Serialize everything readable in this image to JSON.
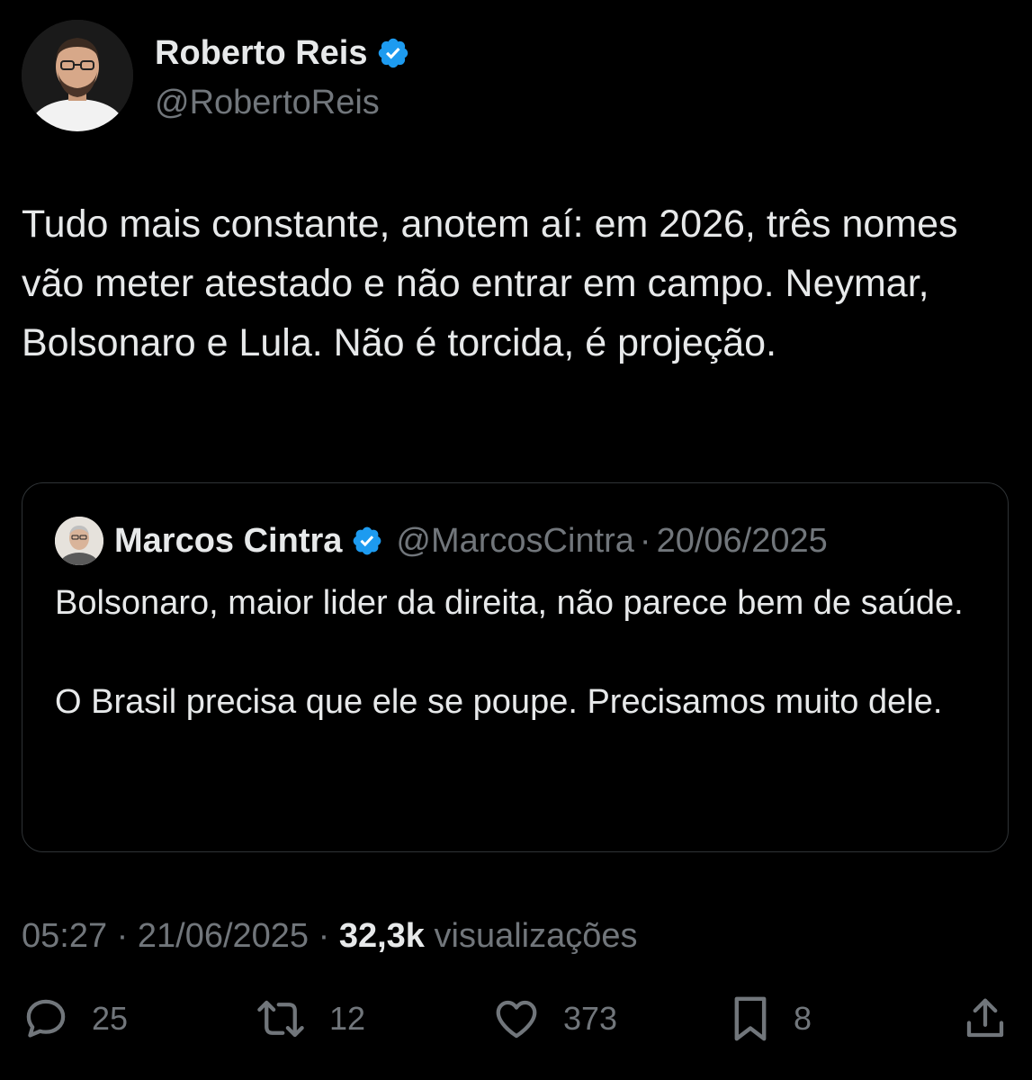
{
  "author": {
    "display_name": "Roberto Reis",
    "handle": "@RobertoReis",
    "verified": true,
    "avatar_icon": "person-avatar"
  },
  "tweet": {
    "text": "Tudo mais constante, anotem aí: em 2026, três nomes vão meter atestado e não entrar em campo. Neymar, Bolsonaro e Lula. Não é torcida, é projeção."
  },
  "quoted_tweet": {
    "display_name": "Marcos Cintra",
    "handle": "@MarcosCintra",
    "separator": "·",
    "date": "20/06/2025",
    "verified": true,
    "paragraphs": [
      "Bolsonaro, maior lider da direita, não parece bem de saúde.",
      "O Brasil precisa que ele se poupe. Precisamos muito dele."
    ]
  },
  "meta": {
    "time": "05:27",
    "separator1": "·",
    "date": "21/06/2025",
    "separator2": "·",
    "views_count": "32,3k",
    "views_label": "visualizações"
  },
  "actions": {
    "reply_count": "25",
    "retweet_count": "12",
    "like_count": "373",
    "bookmark_count": "8"
  },
  "colors": {
    "background": "#000000",
    "text_primary": "#e7e9ea",
    "text_secondary": "#71767b",
    "verified_blue": "#1d9bf0",
    "border": "#2f3336"
  }
}
